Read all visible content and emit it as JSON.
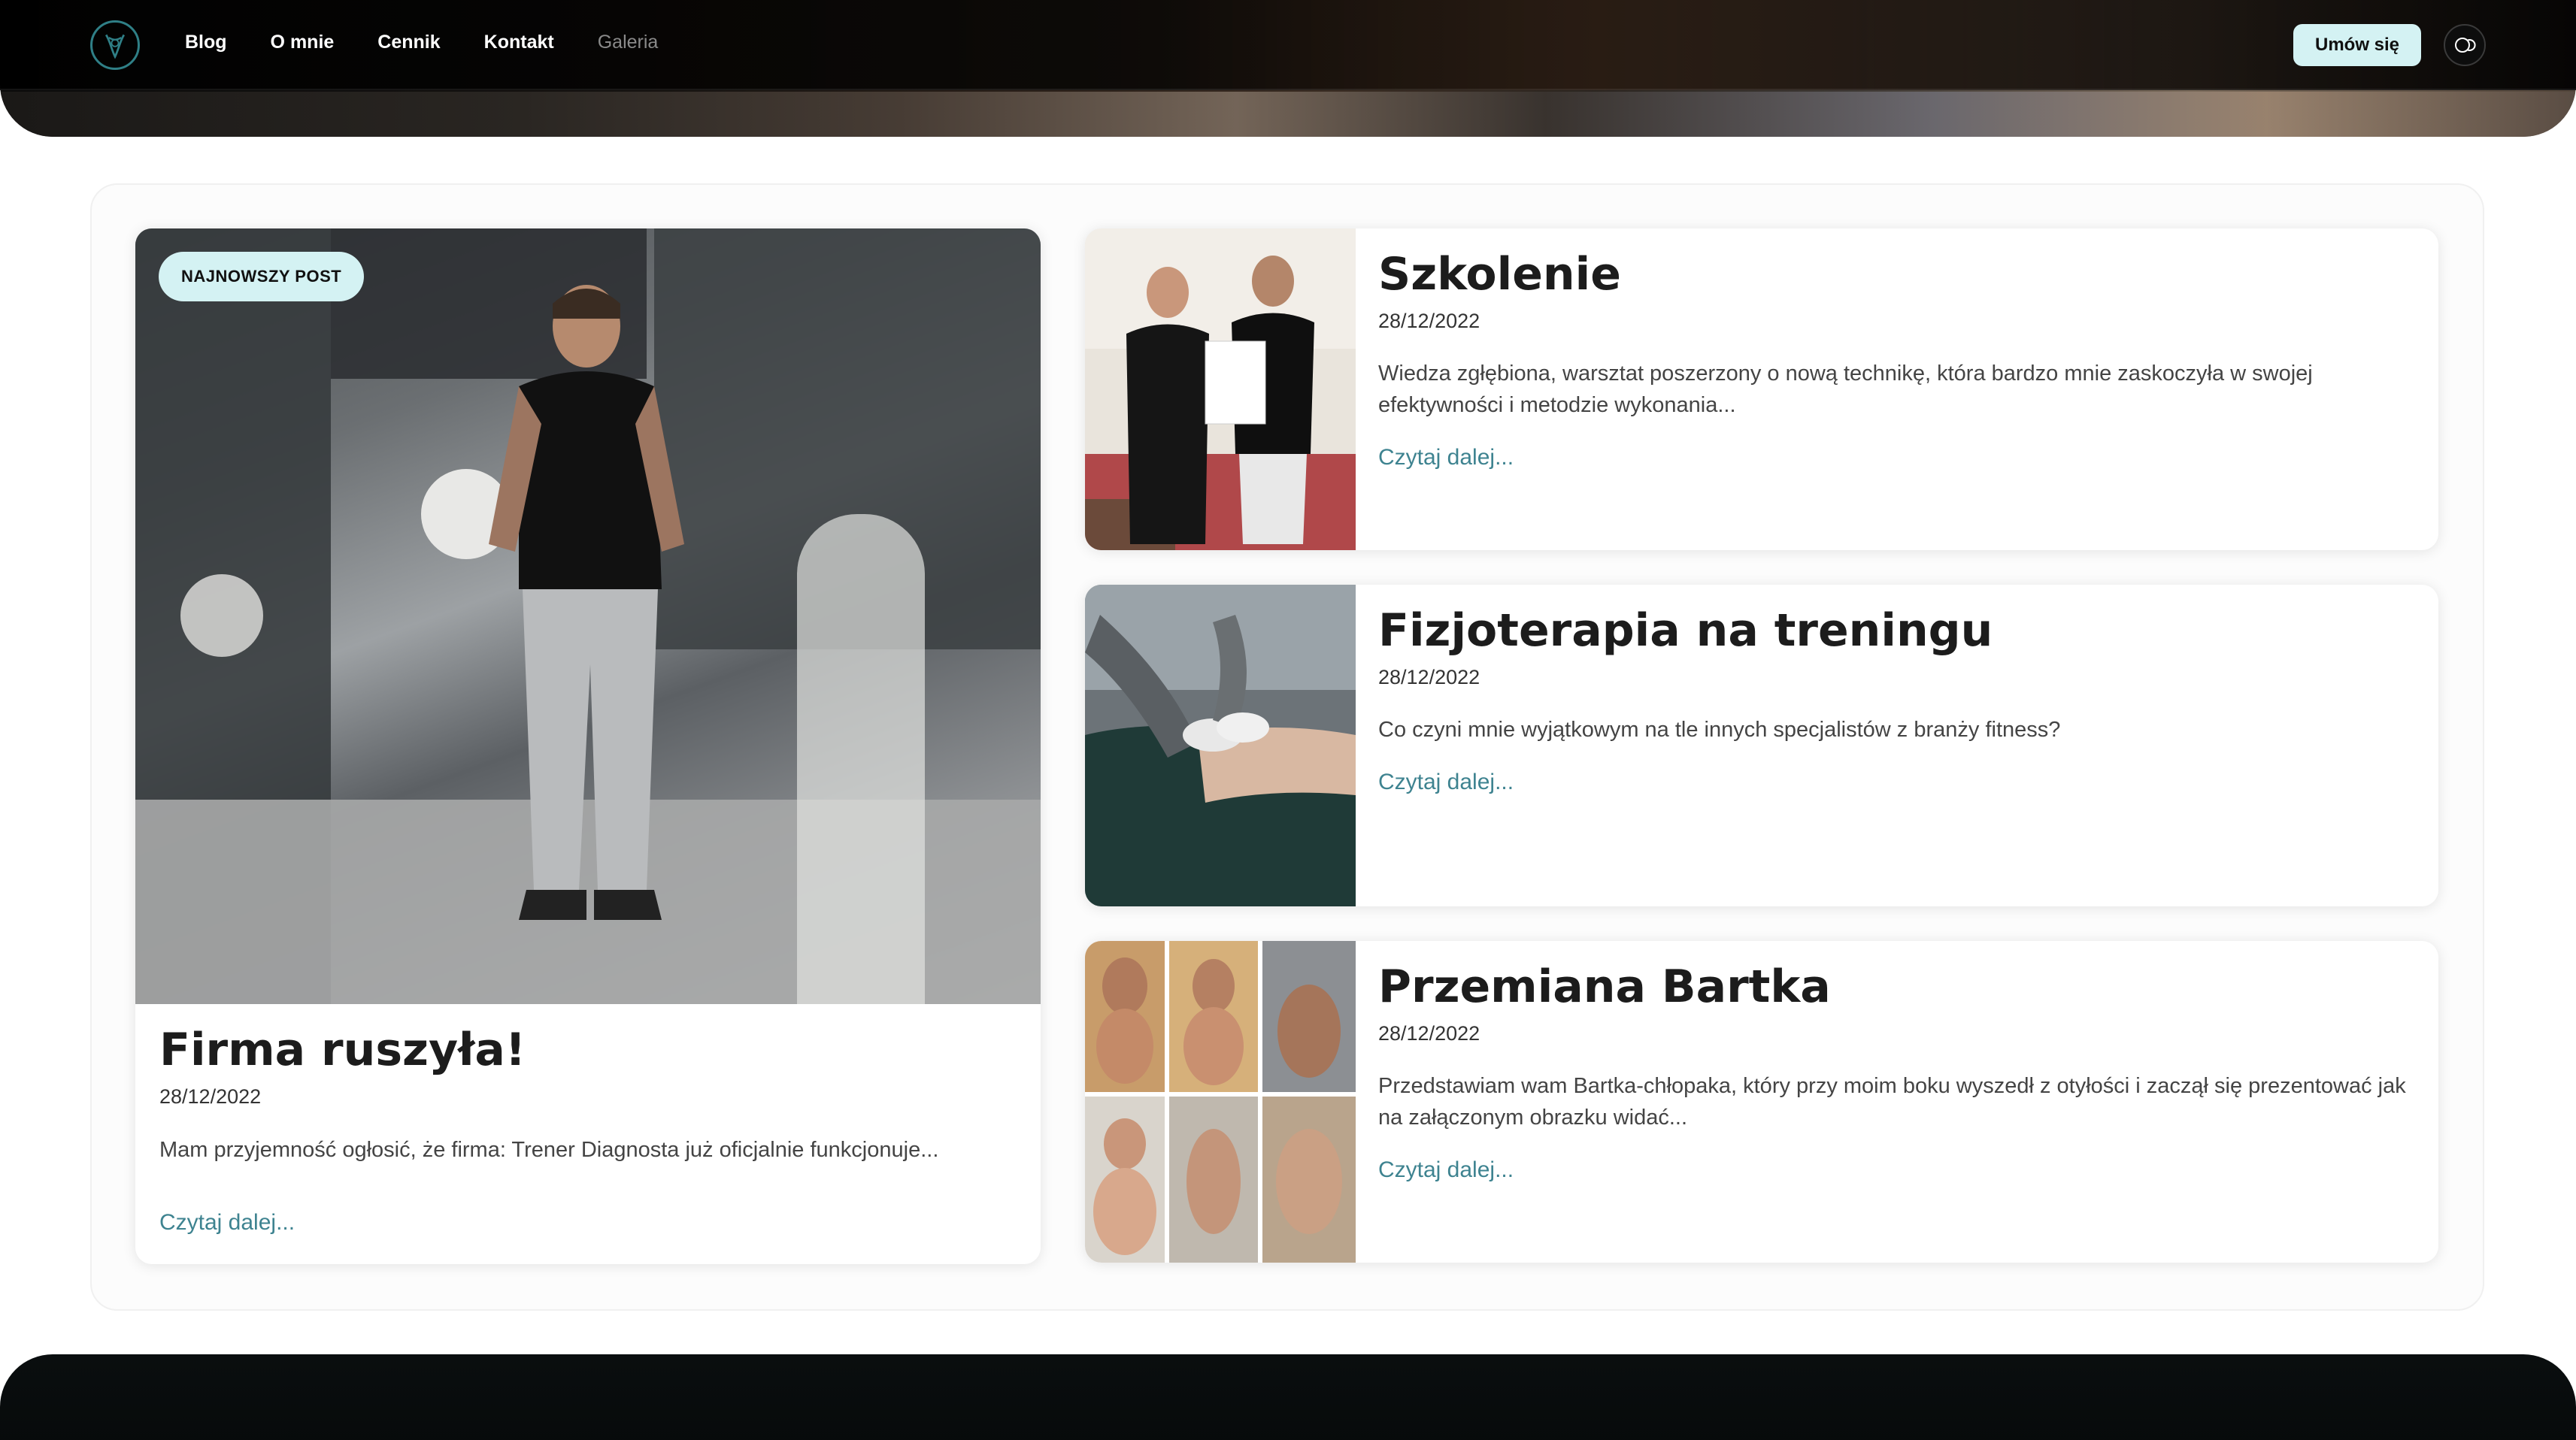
{
  "nav": {
    "logo_icon": "brand-logo-icon",
    "links": [
      "Blog",
      "O mnie",
      "Cennik",
      "Kontakt",
      "Galeria"
    ],
    "cta": "Umów się",
    "theme_toggle_icon": "theme-toggle-icon"
  },
  "featured": {
    "badge": "NAJNOWSZY POST",
    "title": "Firma ruszyła!",
    "date": "28/12/2022",
    "excerpt": "Mam przyjemność ogłosić, że firma: Trener Diagnosta już oficjalnie funkcjonuje...",
    "link": "Czytaj dalej..."
  },
  "posts": [
    {
      "title": "Szkolenie",
      "date": "28/12/2022",
      "excerpt": "Wiedza zgłębiona, warsztat poszerzony o nową technikę, która bardzo mnie zaskoczyła w swojej efektywności i metodzie wykonania...",
      "link": "Czytaj dalej..."
    },
    {
      "title": "Fizjoterapia na treningu",
      "date": "28/12/2022",
      "excerpt": "Co czyni mnie wyjątkowym na tle innych specjalistów z branży fitness?",
      "link": "Czytaj dalej..."
    },
    {
      "title": "Przemiana Bartka",
      "date": "28/12/2022",
      "excerpt": "Przedstawiam wam Bartka-chłopaka, który przy moim boku wyszedł z otyłości i zaczął się prezentować jak na załączonym obrazku widać...",
      "link": "Czytaj dalej..."
    }
  ],
  "colors": {
    "accent": "#d4f2f3",
    "link": "#3e8390",
    "dark": "#0a0e0f"
  }
}
